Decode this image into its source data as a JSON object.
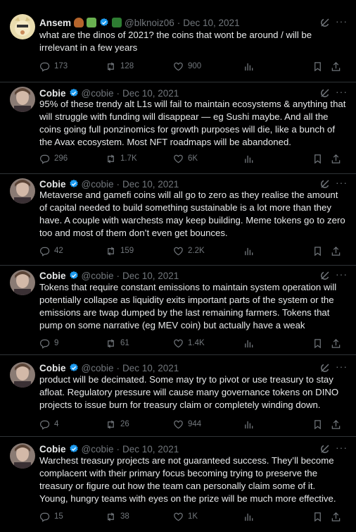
{
  "tweets": [
    {
      "author": "Ansem",
      "handle": "@blknoiz06",
      "date": "Dec 10, 2021",
      "text": "what are the dinos of 2021? the coins that wont be around / will be irrelevant in a few years",
      "replies": "173",
      "retweets": "128",
      "likes": "900"
    },
    {
      "author": "Cobie",
      "handle": "@cobie",
      "date": "Dec 10, 2021",
      "text": "95% of these trendy alt L1s will fail to maintain ecosystems & anything that will struggle with funding will disappear — eg Sushi maybe. And all the coins going full ponzinomics for growth purposes will die, like a bunch of the Avax ecosystem. Most NFT roadmaps will be abandoned.",
      "replies": "296",
      "retweets": "1.7K",
      "likes": "6K"
    },
    {
      "author": "Cobie",
      "handle": "@cobie",
      "date": "Dec 10, 2021",
      "text": "Metaverse and gamefi coins will all go to zero as they realise the amount of capital needed to build something sustainable is a lot more than they have. A couple with warchests may keep building. Meme tokens go to zero too and most of them don’t even get bounces.",
      "replies": "42",
      "retweets": "159",
      "likes": "2.2K"
    },
    {
      "author": "Cobie",
      "handle": "@cobie",
      "date": "Dec 10, 2021",
      "text": "Tokens that require constant emissions to maintain system operation will potentially collapse as liquidity exits important parts of the system or the emissions are twap dumped by the last remaining farmers. Tokens that pump on some narrative (eg MEV coin) but actually have a weak",
      "replies": "9",
      "retweets": "61",
      "likes": "1.4K"
    },
    {
      "author": "Cobie",
      "handle": "@cobie",
      "date": "Dec 10, 2021",
      "text": "product will be decimated. Some may try to pivot or use treasury to stay afloat. Regulatory pressure will cause many governance tokens on DINO projects to issue burn for treasury claim or completely winding down.",
      "replies": "4",
      "retweets": "26",
      "likes": "944"
    },
    {
      "author": "Cobie",
      "handle": "@cobie",
      "date": "Dec 10, 2021",
      "text": "Warchest treasury projects are not guaranteed success. They’ll become complacent with their primary focus becoming trying to preserve the treasury or figure out how the team can personally claim some of it. Young, hungry teams with eyes on the prize will be much more effective.",
      "replies": "15",
      "retweets": "38",
      "likes": "1K"
    }
  ],
  "separator_dot": "·",
  "more_glyph": "···",
  "colors": {
    "background": "#000000",
    "text": "#e7e9ea",
    "muted": "#71767b",
    "verified": "#1d9bf0",
    "separator": "#2f3336"
  },
  "icons": [
    "reply-icon",
    "retweet-icon",
    "like-icon",
    "views-icon",
    "bookmark-icon",
    "share-icon",
    "grok-icon",
    "verified-icon",
    "more-icon"
  ]
}
